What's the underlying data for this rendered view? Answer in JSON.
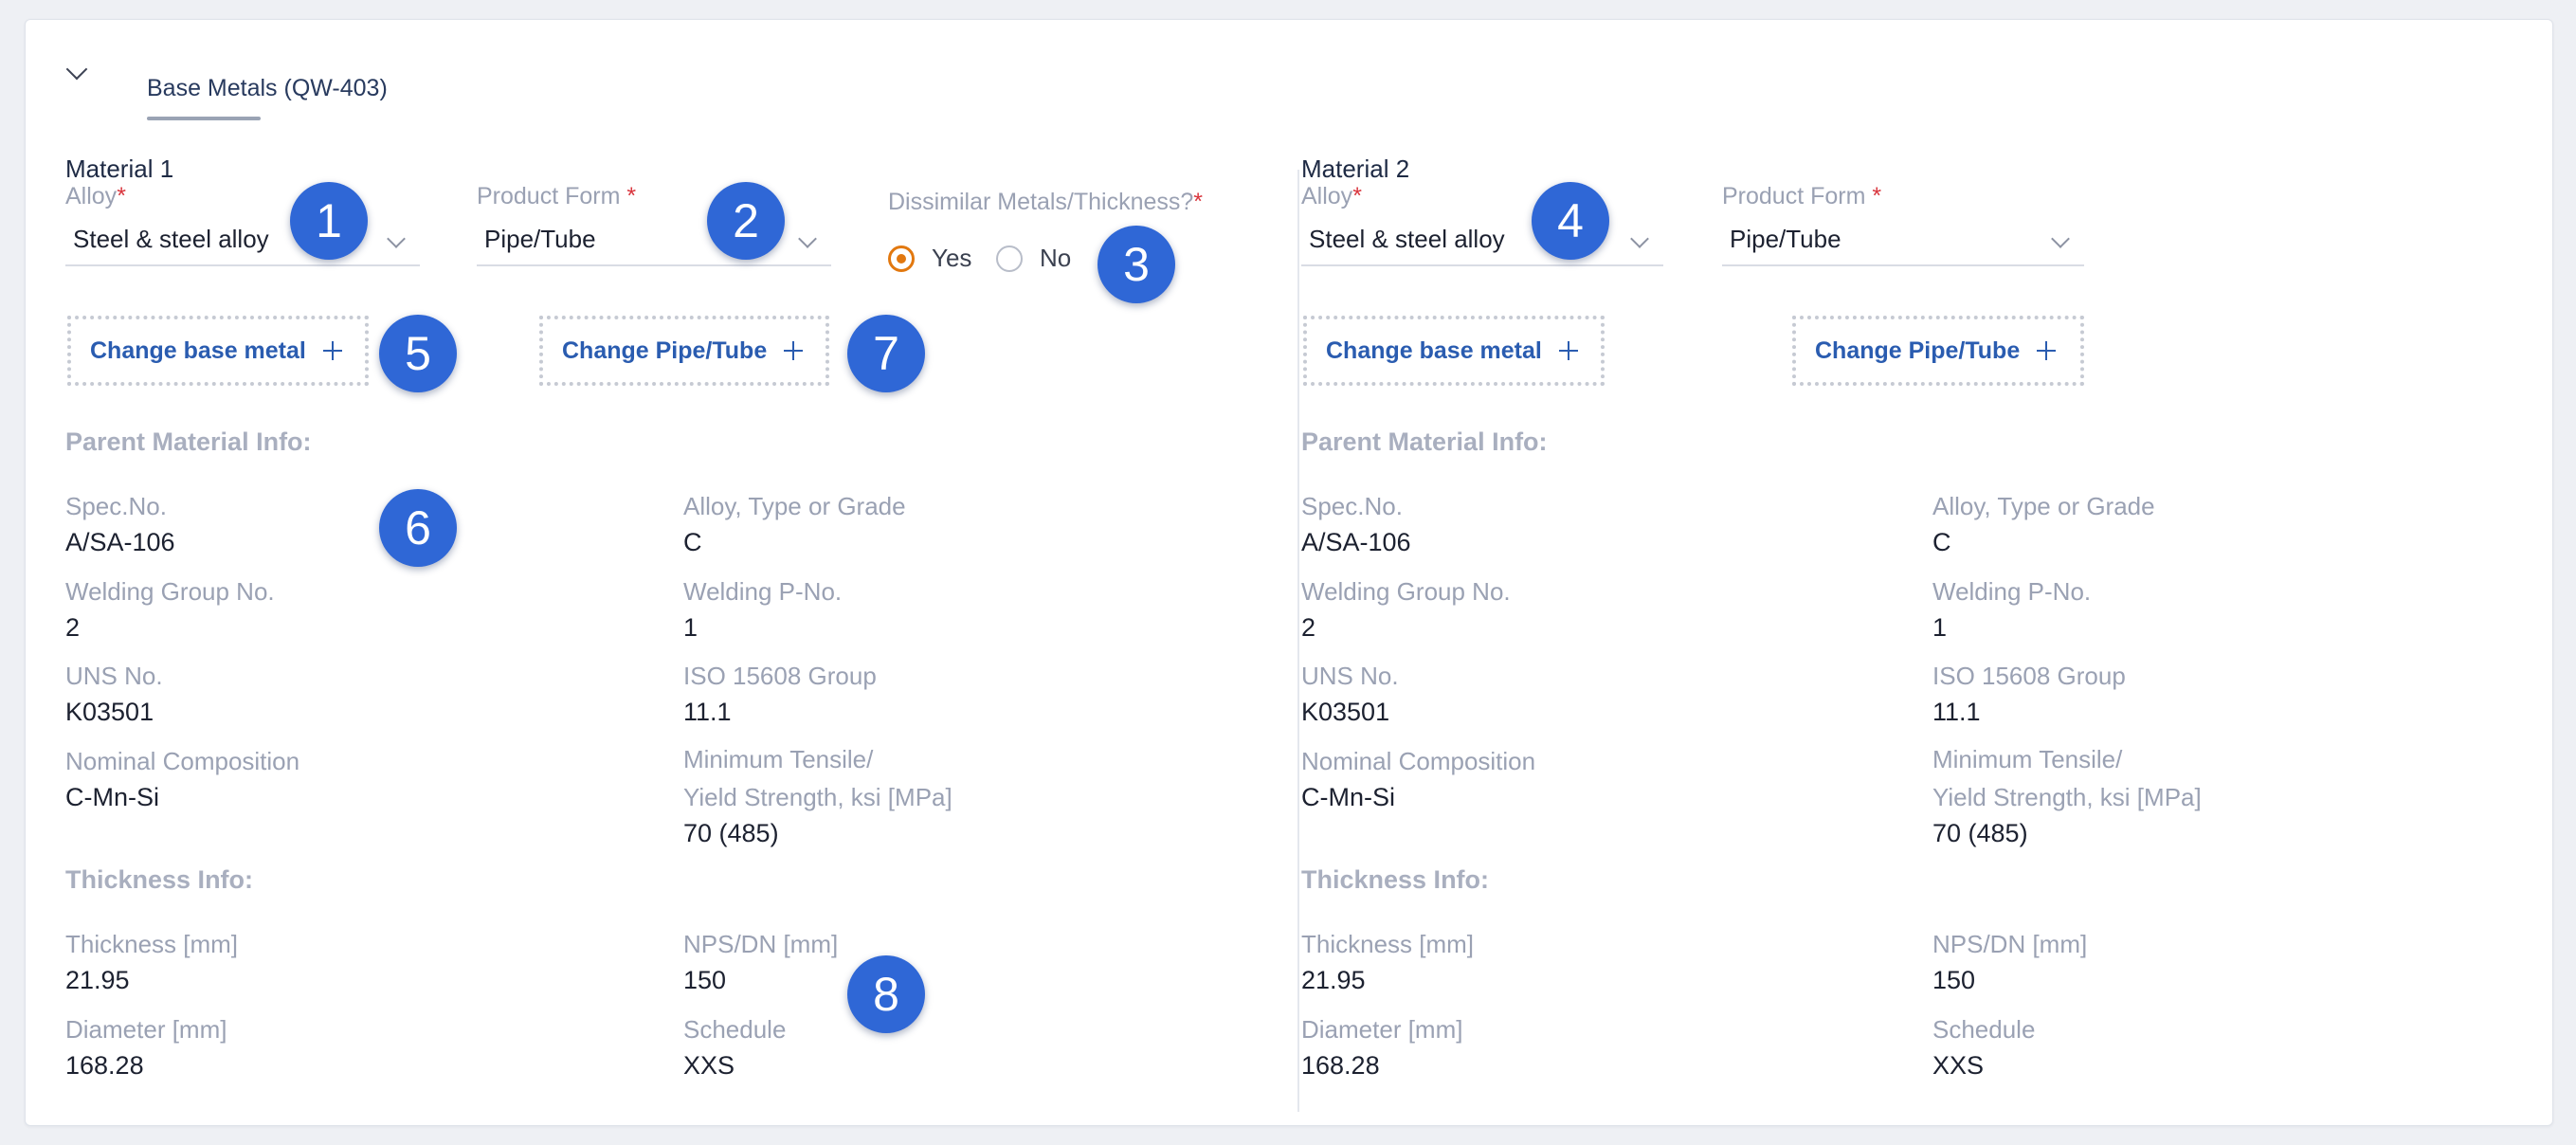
{
  "section": {
    "title": "Base Metals (QW-403)"
  },
  "materials": [
    {
      "title": "Material 1",
      "alloy_label": "Alloy",
      "alloy_value": "Steel & steel alloy",
      "product_form_label": "Product Form ",
      "product_form_value": "Pipe/Tube",
      "change_base_label": "Change base metal",
      "change_form_label": "Change Pipe/Tube",
      "parent_heading": "Parent Material Info:",
      "spec_label": "Spec.No.",
      "spec_value": "A/SA-106",
      "alloy_type_label": "Alloy, Type or Grade",
      "alloy_type_value": "C",
      "wg_label": "Welding Group No.",
      "wg_value": "2",
      "wp_label": "Welding P-No.",
      "wp_value": "1",
      "uns_label": "UNS No.",
      "uns_value": "K03501",
      "iso_label": "ISO 15608 Group",
      "iso_value": "11.1",
      "nominal_label": "Nominal Composition",
      "nominal_value": "C-Mn-Si",
      "tensile_label_1": "Minimum Tensile/",
      "tensile_label_2": "Yield Strength, ksi [MPa]",
      "tensile_value": "70 (485)",
      "thickness_heading": "Thickness Info:",
      "thickness_label": "Thickness [mm]",
      "thickness_value": "21.95",
      "nps_label": "NPS/DN [mm]",
      "nps_value": "150",
      "diameter_label": "Diameter [mm]",
      "diameter_value": "168.28",
      "schedule_label": "Schedule",
      "schedule_value": "XXS"
    },
    {
      "title": "Material 2",
      "alloy_label": "Alloy",
      "alloy_value": "Steel & steel alloy",
      "product_form_label": "Product Form ",
      "product_form_value": "Pipe/Tube",
      "change_base_label": "Change base metal",
      "change_form_label": "Change Pipe/Tube",
      "parent_heading": "Parent Material Info:",
      "spec_label": "Spec.No.",
      "spec_value": "A/SA-106",
      "alloy_type_label": "Alloy, Type or Grade",
      "alloy_type_value": "C",
      "wg_label": "Welding Group No.",
      "wg_value": "2",
      "wp_label": "Welding P-No.",
      "wp_value": "1",
      "uns_label": "UNS No.",
      "uns_value": "K03501",
      "iso_label": "ISO 15608 Group",
      "iso_value": "11.1",
      "nominal_label": "Nominal Composition",
      "nominal_value": "C-Mn-Si",
      "tensile_label_1": "Minimum Tensile/",
      "tensile_label_2": "Yield Strength, ksi [MPa]",
      "tensile_value": "70 (485)",
      "thickness_heading": "Thickness Info:",
      "thickness_label": "Thickness [mm]",
      "thickness_value": "21.95",
      "nps_label": "NPS/DN [mm]",
      "nps_value": "150",
      "diameter_label": "Diameter [mm]",
      "diameter_value": "168.28",
      "schedule_label": "Schedule",
      "schedule_value": "XXS"
    }
  ],
  "dissimilar": {
    "label": "Dissimilar Metals/Thickness?",
    "required_mark": "*",
    "options": [
      "Yes",
      "No"
    ],
    "selected": "Yes"
  },
  "required_mark": "*",
  "badges": [
    "1",
    "2",
    "3",
    "4",
    "5",
    "6",
    "7",
    "8"
  ],
  "colors": {
    "accent": "#2a5cb0",
    "radio_selected": "#e2780f",
    "badge": "#2f67d6",
    "required": "#d9363e"
  }
}
